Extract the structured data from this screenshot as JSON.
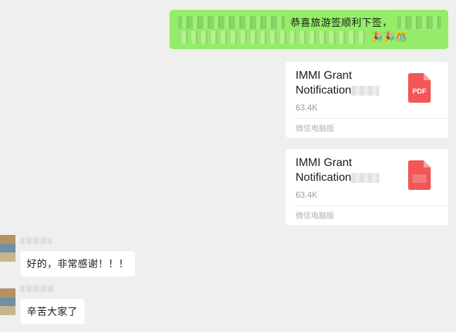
{
  "outgoing_text": {
    "visible_text": "恭喜旅游签顺利下签，",
    "emoji": "🎉🎉🎊"
  },
  "file_cards": [
    {
      "name": "IMMI Grant Notification",
      "size": "63.4K",
      "source": "微信电脑版",
      "icon": "pdf-file-icon",
      "icon_label": "PDF",
      "icon_color": "#f25656"
    },
    {
      "name": "IMMI Grant Notification",
      "size": "63.4K",
      "source": "微信电脑版",
      "icon": "pdf-file-icon",
      "icon_color": "#f25656"
    }
  ],
  "incoming": [
    {
      "text": "好的，非常感谢！！！"
    },
    {
      "text": "辛苦大家了"
    }
  ],
  "colors": {
    "background": "#efefef",
    "outgoing_bubble": "#95ec69",
    "incoming_bubble": "#ffffff",
    "pdf": "#f25656"
  }
}
